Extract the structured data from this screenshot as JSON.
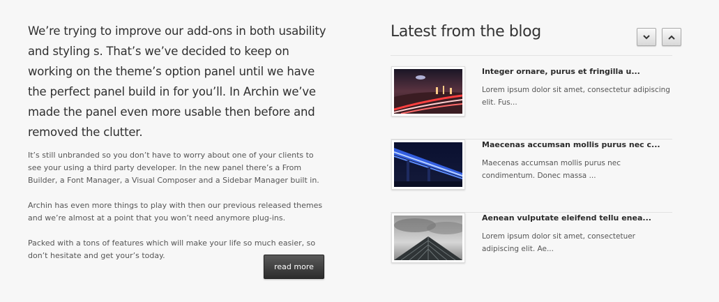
{
  "intro": {
    "lead": "We’re trying to improve our add-ons in both usability and styling s. That’s we’ve decided to keep on working on the theme’s option panel until we have the perfect panel build in for you’ll. In Archin we’ve made the panel even more usable then before and removed the clutter.",
    "paragraphs": [
      "It’s still unbranded so you don’t have to worry about one of your clients to see your using a third party developer. In the new panel there’s a From Builder, a Font Manager, a Visual Composer and a Sidebar Manager built in.",
      "Archin has even more things to play with then our previous released themes and we’re almost at a point that you won’t need anymore plug-ins.",
      "Packed with a tons of features which will make your life so much easier, so don’t hesitate and get your’s today."
    ],
    "read_more_label": "read more"
  },
  "blog": {
    "title": "Latest from the blog",
    "nav": {
      "down_icon": "chevron-down-icon",
      "up_icon": "chevron-up-icon"
    },
    "posts": [
      {
        "title": "Integer ornare, purus et fringilla u...",
        "excerpt": "Lorem ipsum dolor sit amet, consectetur adipiscing elit. Fus...",
        "thumb": "city-night-light-trails"
      },
      {
        "title": "Maecenas accumsan mollis purus nec c...",
        "excerpt": "Maecenas accumsan mollis purus nec condimentum. Donec massa ...",
        "thumb": "blue-lit-bridge"
      },
      {
        "title": "Aenean vulputate eleifend tellu enea...",
        "excerpt": "Lorem ipsum dolor sit amet, consectetuer adipiscing elit. Ae...",
        "thumb": "glass-building-sky"
      }
    ]
  }
}
